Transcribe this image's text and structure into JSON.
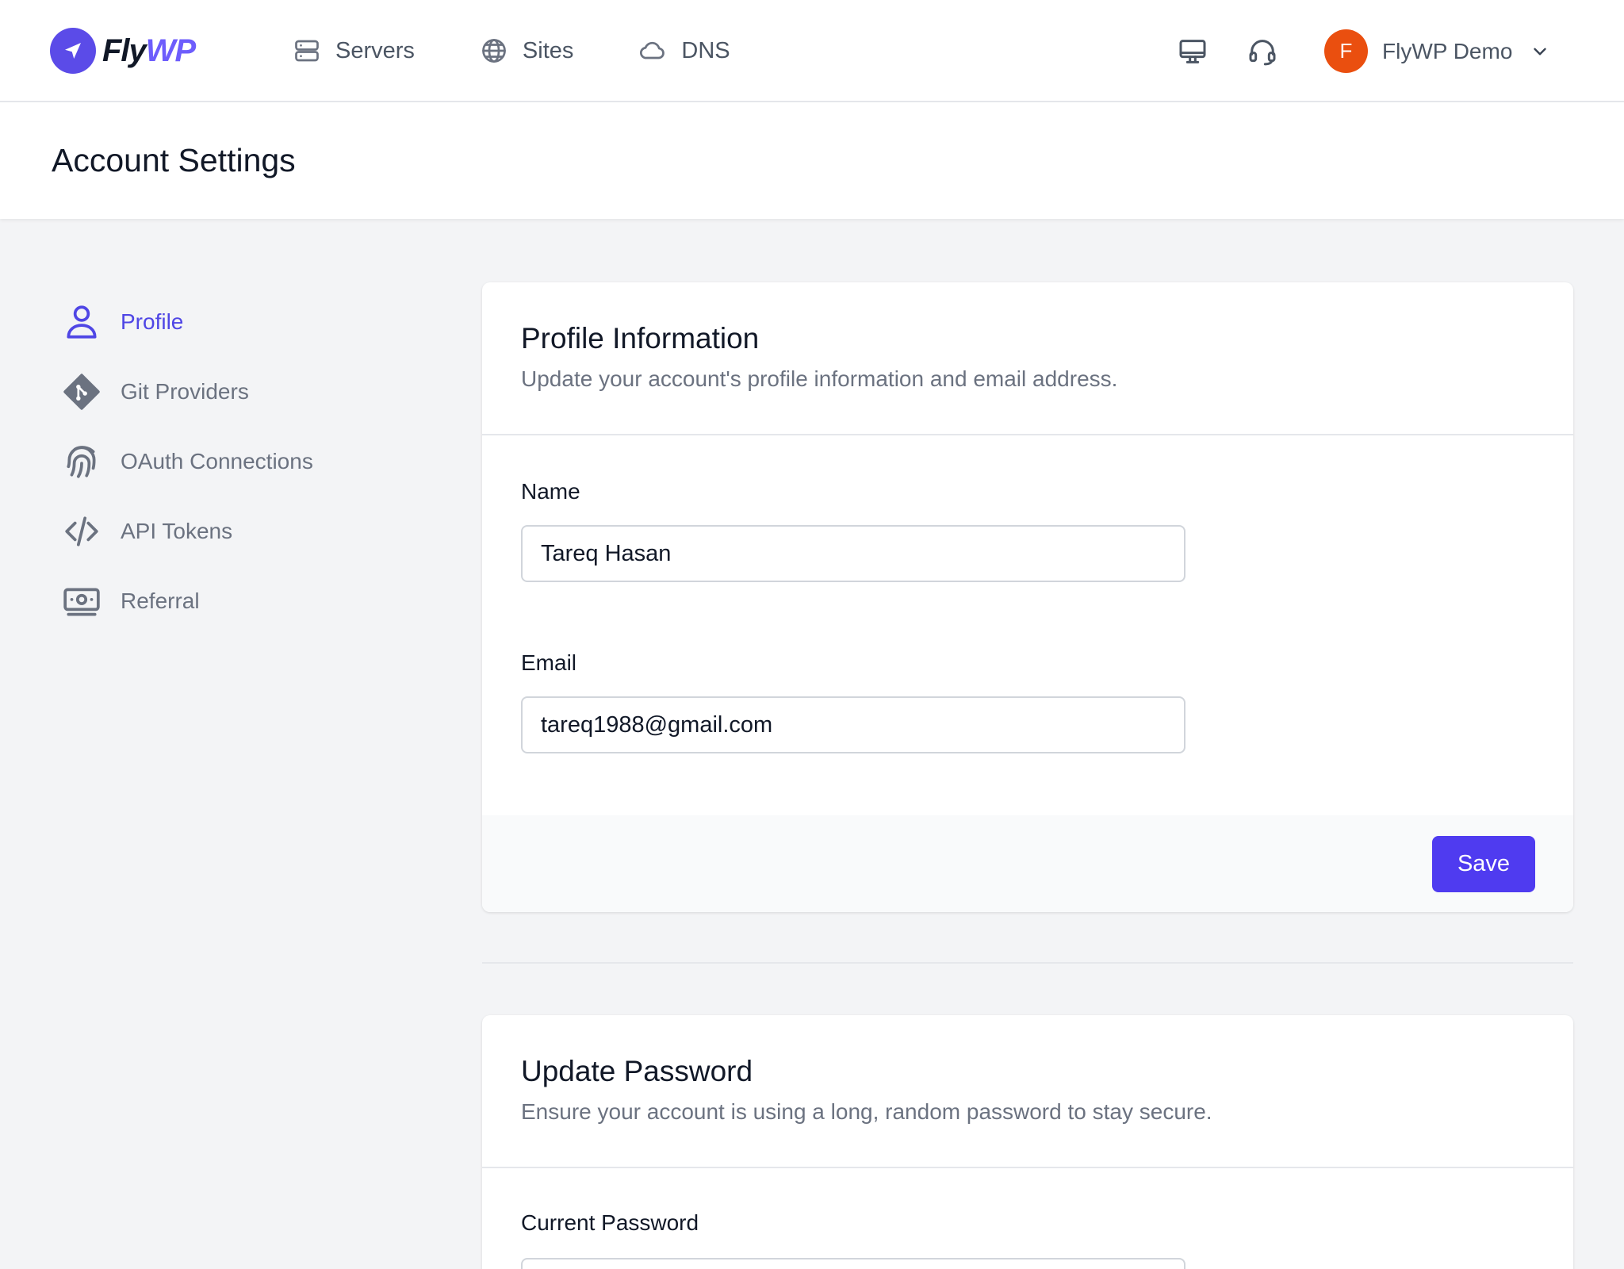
{
  "brand": {
    "name_part1": "Fly",
    "name_part2": "WP",
    "accent": "#5b4be8"
  },
  "nav": {
    "items": [
      {
        "label": "Servers",
        "icon": "server-icon"
      },
      {
        "label": "Sites",
        "icon": "globe-icon"
      },
      {
        "label": "DNS",
        "icon": "cloud-icon"
      }
    ]
  },
  "topbar": {
    "icons": [
      "monitor-icon",
      "headset-icon"
    ],
    "user": {
      "initial": "F",
      "name": "FlyWP Demo",
      "avatar_color": "#ea4f0f"
    }
  },
  "page": {
    "title": "Account Settings"
  },
  "sidebar": {
    "items": [
      {
        "label": "Profile",
        "icon": "user-icon",
        "active": true
      },
      {
        "label": "Git Providers",
        "icon": "git-icon",
        "active": false
      },
      {
        "label": "OAuth Connections",
        "icon": "fingerprint-icon",
        "active": false
      },
      {
        "label": "API Tokens",
        "icon": "code-icon",
        "active": false
      },
      {
        "label": "Referral",
        "icon": "money-icon",
        "active": false
      }
    ]
  },
  "profile_card": {
    "title": "Profile Information",
    "description": "Update your account's profile information and email address.",
    "name_label": "Name",
    "name_value": "Tareq Hasan",
    "email_label": "Email",
    "email_value": "tareq1988@gmail.com",
    "save_label": "Save"
  },
  "password_card": {
    "title": "Update Password",
    "description": "Ensure your account is using a long, random password to stay secure.",
    "current_label": "Current Password"
  },
  "colors": {
    "primary_button": "#4f3bf0",
    "active_nav": "#4f46e5"
  }
}
